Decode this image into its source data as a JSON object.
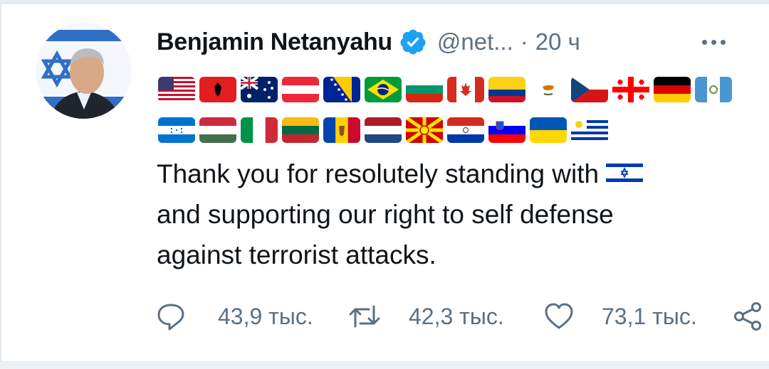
{
  "tweet": {
    "author_name": "Benjamin Netanyahu",
    "handle": "@net...",
    "separator": "·",
    "time": "20 ч",
    "text_line1": "Thank you for resolutely standing with",
    "text_line2": "and supporting our right to self defense",
    "text_line3": "against terrorist attacks.",
    "inline_flag": "israel-flag-icon"
  },
  "flags_row1": [
    "united-states-flag-icon",
    "albania-flag-icon",
    "australia-flag-icon",
    "austria-flag-icon",
    "bosnia-flag-icon",
    "brazil-flag-icon",
    "bulgaria-flag-icon",
    "canada-flag-icon",
    "colombia-flag-icon",
    "cyprus-flag-icon",
    "czech-flag-icon",
    "georgia-flag-icon",
    "germany-flag-icon",
    "guatemala-flag-icon"
  ],
  "flags_row2": [
    "honduras-flag-icon",
    "hungary-flag-icon",
    "italy-flag-icon",
    "lithuania-flag-icon",
    "moldova-flag-icon",
    "netherlands-flag-icon",
    "north-macedonia-flag-icon",
    "paraguay-flag-icon",
    "slovenia-flag-icon",
    "ukraine-flag-icon",
    "uruguay-flag-icon"
  ],
  "actions": {
    "reply_count": "43,9 тыс.",
    "retweet_count": "42,3 тыс.",
    "like_count": "73,1 тыс."
  },
  "colors": {
    "verified": "#1da1f2",
    "muted": "#5b7083",
    "text": "#0f1419"
  }
}
